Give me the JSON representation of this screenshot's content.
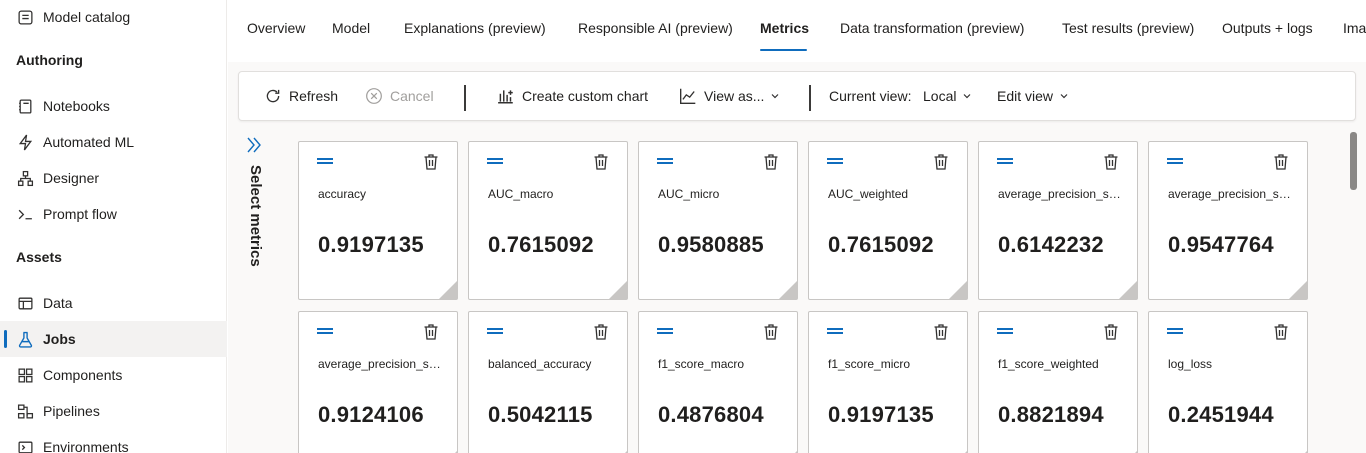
{
  "sidebar": {
    "items": [
      {
        "label": "Model catalog",
        "icon": "model-catalog-icon"
      },
      {
        "label": "Notebooks",
        "icon": "notebook-icon"
      },
      {
        "label": "Automated ML",
        "icon": "lightning-icon"
      },
      {
        "label": "Designer",
        "icon": "designer-icon"
      },
      {
        "label": "Prompt flow",
        "icon": "prompt-icon"
      },
      {
        "label": "Data",
        "icon": "data-icon"
      },
      {
        "label": "Jobs",
        "icon": "flask-icon",
        "active": true
      },
      {
        "label": "Components",
        "icon": "components-icon"
      },
      {
        "label": "Pipelines",
        "icon": "pipeline-icon"
      },
      {
        "label": "Environments",
        "icon": "environment-icon"
      }
    ],
    "sections": {
      "authoring": "Authoring",
      "assets": "Assets"
    }
  },
  "tabs": [
    {
      "label": "Overview"
    },
    {
      "label": "Model"
    },
    {
      "label": "Explanations (preview)"
    },
    {
      "label": "Responsible AI (preview)"
    },
    {
      "label": "Metrics",
      "active": true
    },
    {
      "label": "Data transformation (preview)"
    },
    {
      "label": "Test results (preview)"
    },
    {
      "label": "Outputs + logs"
    },
    {
      "label": "Ima"
    }
  ],
  "toolbar": {
    "refresh": "Refresh",
    "cancel": "Cancel",
    "create_chart": "Create custom chart",
    "view_as": "View as...",
    "current_view_label": "Current view:",
    "current_view_value": "Local",
    "edit_view": "Edit view"
  },
  "metrics_panel": {
    "label": "Select metrics"
  },
  "metrics": [
    {
      "name": "accuracy",
      "value": "0.9197135"
    },
    {
      "name": "AUC_macro",
      "value": "0.7615092"
    },
    {
      "name": "AUC_micro",
      "value": "0.9580885"
    },
    {
      "name": "AUC_weighted",
      "value": "0.7615092"
    },
    {
      "name": "average_precision_sco...",
      "value": "0.6142232"
    },
    {
      "name": "average_precision_sco...",
      "value": "0.9547764"
    },
    {
      "name": "average_precision_sco...",
      "value": "0.9124106"
    },
    {
      "name": "balanced_accuracy",
      "value": "0.5042115"
    },
    {
      "name": "f1_score_macro",
      "value": "0.4876804"
    },
    {
      "name": "f1_score_micro",
      "value": "0.9197135"
    },
    {
      "name": "f1_score_weighted",
      "value": "0.8821894"
    },
    {
      "name": "log_loss",
      "value": "0.2451944"
    }
  ],
  "colors": {
    "accent": "#0f6cbd",
    "border": "#c8c6c4",
    "disabled": "#a19f9d"
  }
}
